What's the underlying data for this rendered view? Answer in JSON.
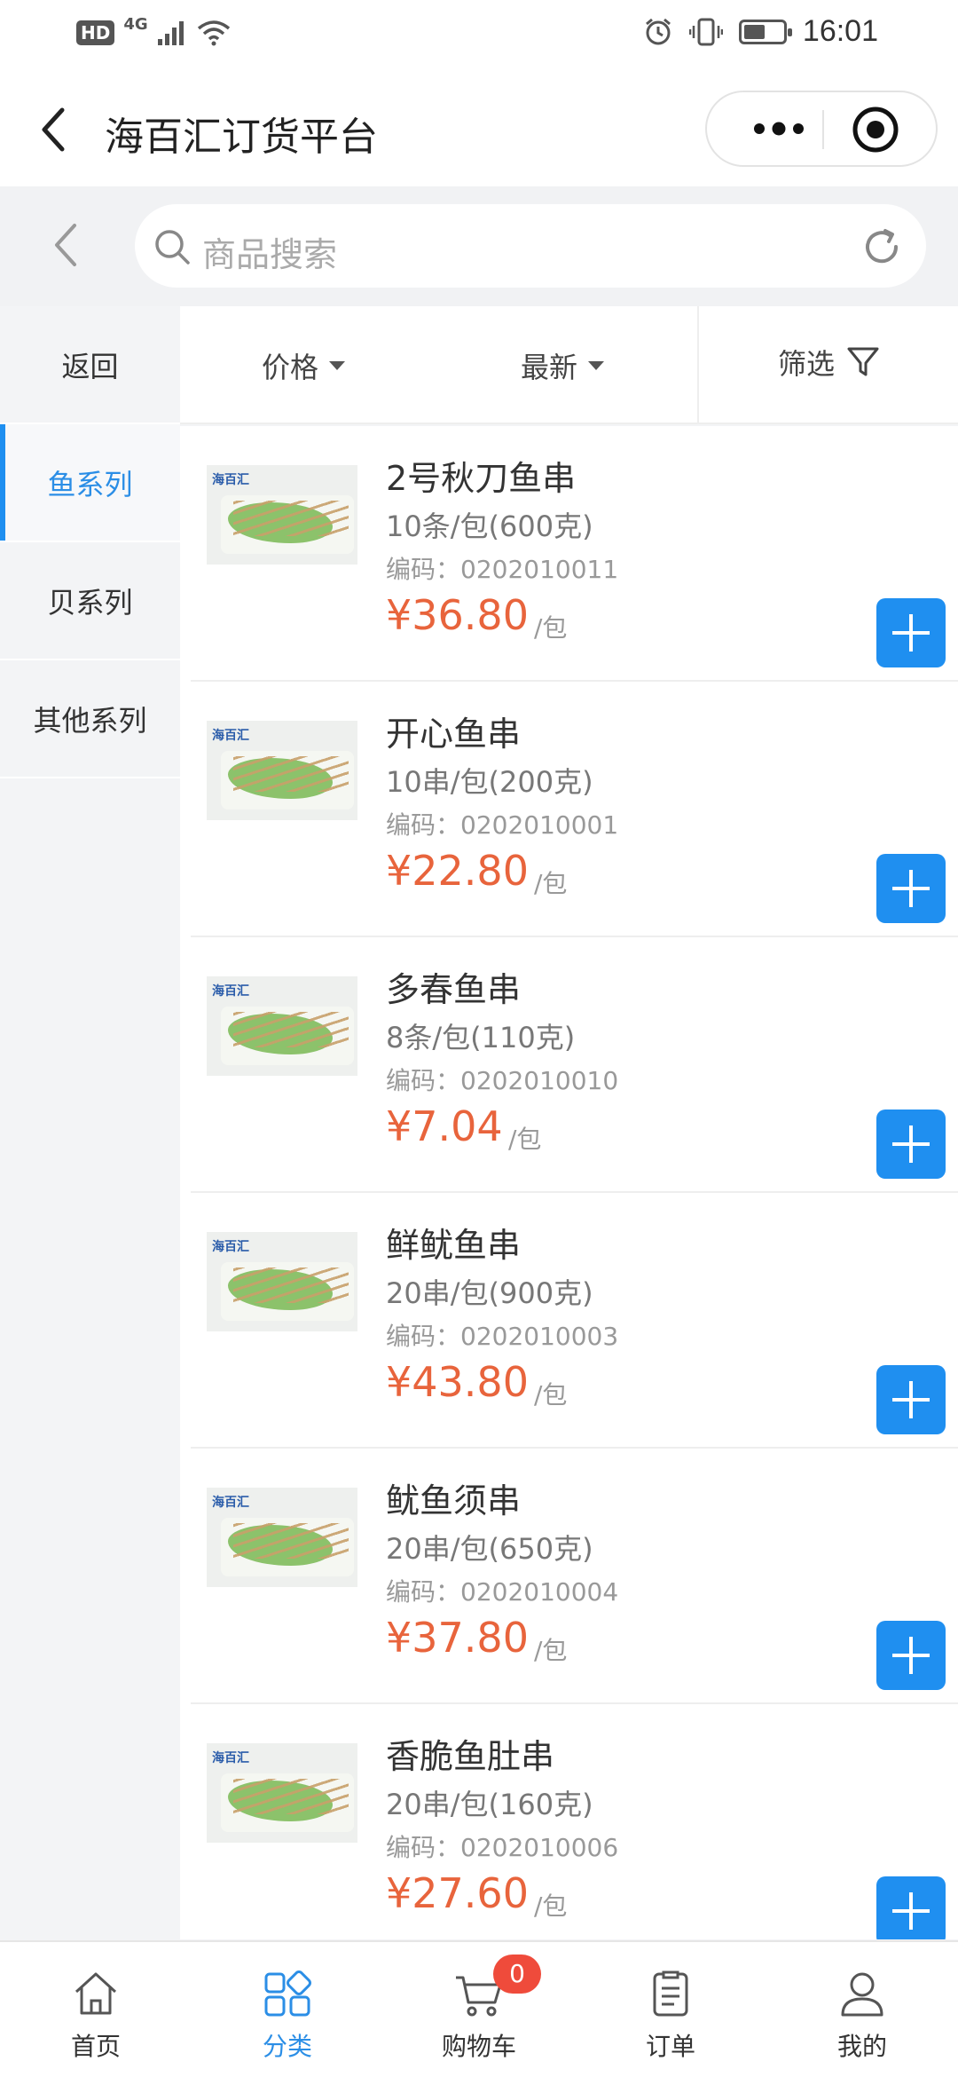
{
  "status": {
    "network": "4G",
    "hd": "HD",
    "time": "16:01",
    "battery_level": 0.55
  },
  "nav": {
    "title": "海百汇订货平台"
  },
  "search": {
    "placeholder": "商品搜索"
  },
  "sidebar": {
    "back": "返回",
    "items": [
      {
        "label": "鱼系列",
        "active": true
      },
      {
        "label": "贝系列"
      },
      {
        "label": "其他系列"
      }
    ]
  },
  "sort": {
    "price": "价格",
    "newest": "最新",
    "filter": "筛选"
  },
  "image_brand": "海百汇",
  "products": [
    {
      "name": "2号秋刀鱼串",
      "spec": "10条/包(600克)",
      "code": "编码：0202010011",
      "price": "¥36.80",
      "unit": "/包"
    },
    {
      "name": "开心鱼串",
      "spec": "10串/包(200克)",
      "code": "编码：0202010001",
      "price": "¥22.80",
      "unit": "/包"
    },
    {
      "name": "多春鱼串",
      "spec": "8条/包(110克)",
      "code": "编码：0202010010",
      "price": "¥7.04",
      "unit": "/包"
    },
    {
      "name": "鲜鱿鱼串",
      "spec": "20串/包(900克)",
      "code": "编码：0202010003",
      "price": "¥43.80",
      "unit": "/包"
    },
    {
      "name": "鱿鱼须串",
      "spec": "20串/包(650克)",
      "code": "编码：0202010004",
      "price": "¥37.80",
      "unit": "/包"
    },
    {
      "name": "香脆鱼肚串",
      "spec": "20串/包(160克)",
      "code": "编码：0202010006",
      "price": "¥27.60",
      "unit": "/包"
    }
  ],
  "tabs": [
    {
      "label": "首页"
    },
    {
      "label": "分类",
      "active": true
    },
    {
      "label": "购物车",
      "badge": "0"
    },
    {
      "label": "订单"
    },
    {
      "label": "我的"
    }
  ],
  "colors": {
    "accent": "#1f8ff0",
    "price": "#e8643c",
    "badge": "#ef4b3b"
  }
}
